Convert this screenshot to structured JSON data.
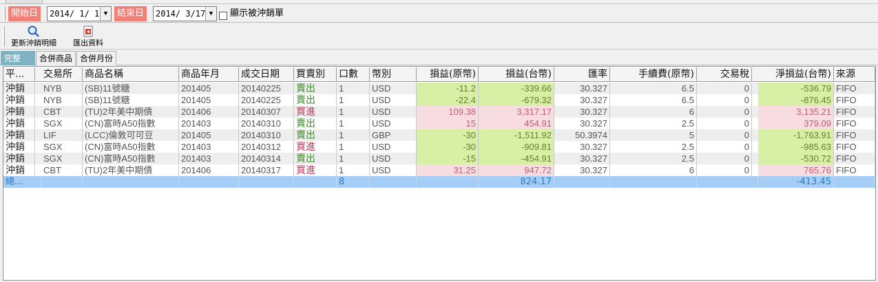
{
  "filters": {
    "start_label": "開始日",
    "start_date": "2014/  1/  1",
    "end_label": "結束日",
    "end_date": "2014/  3/17",
    "show_offset_label": "顯示被沖銷單"
  },
  "toolbar": {
    "refresh_label": "更新沖銷明細",
    "export_label": "匯出資料"
  },
  "tabs": [
    {
      "label": "完整",
      "active": true
    },
    {
      "label": "合併商品",
      "active": false
    },
    {
      "label": "合併月份",
      "active": false
    }
  ],
  "table": {
    "columns": [
      "平...",
      "交易所",
      "商品名稱",
      "商品年月",
      "成交日期",
      "買賣別",
      "口數",
      "幣別",
      "損益(原幣)",
      "損益(台幣)",
      "匯率",
      "手續費(原幣)",
      "交易稅",
      "淨損益(台幣)",
      "來源"
    ],
    "rows": [
      [
        "沖銷",
        "NYB",
        "(SB)11號糖",
        "201405",
        "20140225",
        "賣出",
        "1",
        "USD",
        "-11.2",
        "-339.66",
        "30.327",
        "6.5",
        "0",
        "-536.79",
        "FIFO"
      ],
      [
        "沖銷",
        "NYB",
        "(SB)11號糖",
        "201405",
        "20140225",
        "賣出",
        "1",
        "USD",
        "-22.4",
        "-679.32",
        "30.327",
        "6.5",
        "0",
        "-876.45",
        "FIFO"
      ],
      [
        "沖銷",
        "CBT",
        "(TU)2年美中期債",
        "201406",
        "20140307",
        "買進",
        "1",
        "USD",
        "109.38",
        "3,317.17",
        "30.327",
        "6",
        "0",
        "3,135.21",
        "FIFO"
      ],
      [
        "沖銷",
        "SGX",
        "(CN)富時A50指數",
        "201403",
        "20140310",
        "賣出",
        "1",
        "USD",
        "15",
        "454.91",
        "30.327",
        "2.5",
        "0",
        "379.09",
        "FIFO"
      ],
      [
        "沖銷",
        "LIF",
        "(LCC)倫敦可可豆",
        "201405",
        "20140310",
        "賣出",
        "1",
        "GBP",
        "-30",
        "-1,511.92",
        "50.3974",
        "5",
        "0",
        "-1,763.91",
        "FIFO"
      ],
      [
        "沖銷",
        "SGX",
        "(CN)富時A50指數",
        "201403",
        "20140312",
        "買進",
        "1",
        "USD",
        "-30",
        "-909.81",
        "30.327",
        "2.5",
        "0",
        "-985.63",
        "FIFO"
      ],
      [
        "沖銷",
        "SGX",
        "(CN)富時A50指數",
        "201403",
        "20140314",
        "賣出",
        "1",
        "USD",
        "-15",
        "-454.91",
        "30.327",
        "2.5",
        "0",
        "-530.72",
        "FIFO"
      ],
      [
        "沖銷",
        "CBT",
        "(TU)2年美中期債",
        "201406",
        "20140317",
        "買進",
        "1",
        "USD",
        "31.25",
        "947.72",
        "30.327",
        "6",
        "0",
        "765.76",
        "FIFO"
      ]
    ],
    "total": {
      "label": "總...",
      "qty": "8",
      "pl_twd": "824.17",
      "net_twd": "-413.45"
    }
  },
  "colors": {
    "accent_label_bg": "#f08078",
    "active_tab_bg": "#7fb3c4",
    "profit_bg": "#f7dde2",
    "loss_bg": "#d7f0a6",
    "total_row_bg": "#a6cdf5"
  }
}
